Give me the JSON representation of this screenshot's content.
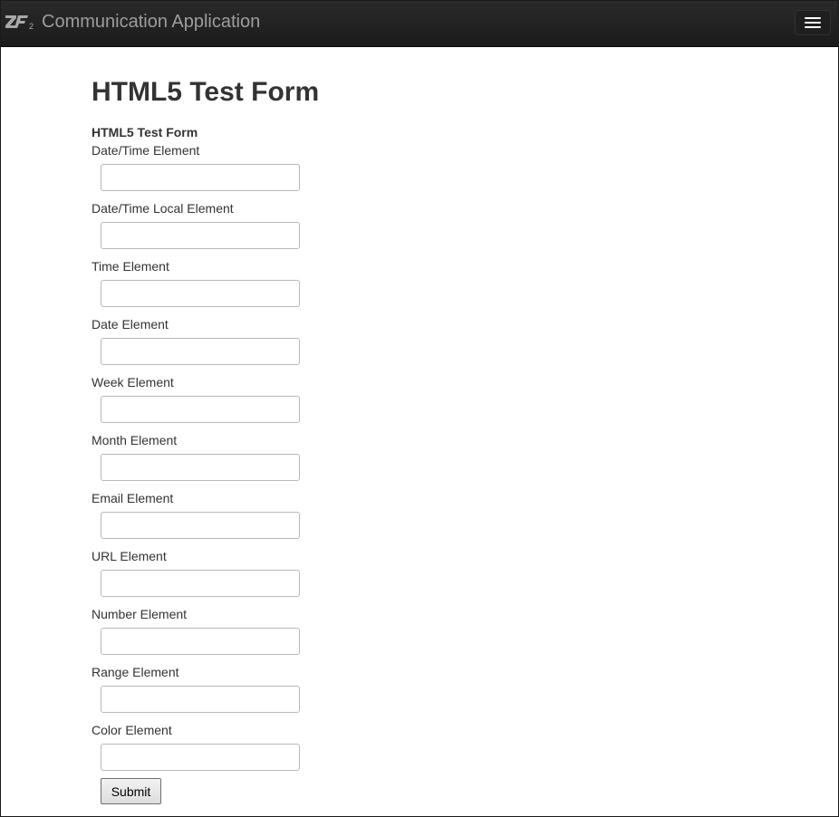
{
  "navbar": {
    "logo_icon": "zend-framework-2-logo",
    "title": "Communication Application",
    "menu_icon": "hamburger-menu-icon"
  },
  "page": {
    "heading": "HTML5 Test Form",
    "form_legend": "HTML5 Test Form"
  },
  "form": {
    "fields": [
      {
        "label": "Date/Time Element",
        "value": ""
      },
      {
        "label": "Date/Time Local Element",
        "value": ""
      },
      {
        "label": "Time Element",
        "value": ""
      },
      {
        "label": "Date Element",
        "value": ""
      },
      {
        "label": "Week Element",
        "value": ""
      },
      {
        "label": "Month Element",
        "value": ""
      },
      {
        "label": "Email Element",
        "value": ""
      },
      {
        "label": "URL Element",
        "value": ""
      },
      {
        "label": "Number Element",
        "value": ""
      },
      {
        "label": "Range Element",
        "value": ""
      },
      {
        "label": "Color Element",
        "value": ""
      }
    ],
    "submit_label": "Submit"
  },
  "colors": {
    "navbar_bg": "#222222",
    "navbar_text": "#9d9d9d",
    "body_text": "#333333",
    "input_border": "#b9b9b9"
  }
}
